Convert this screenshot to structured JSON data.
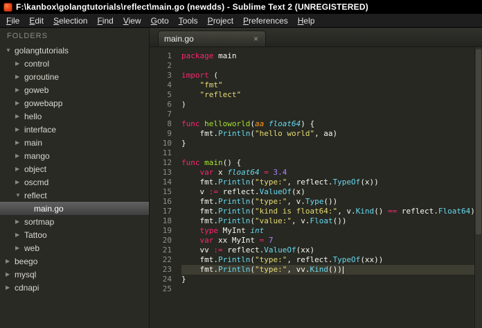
{
  "window": {
    "title": "F:\\kanbox\\golangtutorials\\reflect\\main.go (newdds) - Sublime Text 2 (UNREGISTERED)"
  },
  "menu": {
    "items": [
      "File",
      "Edit",
      "Selection",
      "Find",
      "View",
      "Goto",
      "Tools",
      "Project",
      "Preferences",
      "Help"
    ]
  },
  "icons": {
    "close": "×",
    "folder_expanded": "▼",
    "folder_collapsed": "▶"
  },
  "theme": {
    "editor_bg": "#272822",
    "sidebar_bg": "#2a2a25",
    "current_line_bg": "#3e3d32",
    "keyword": "#f92672",
    "function_name": "#a6e22e",
    "type": "#66d9ef",
    "param": "#fd971f",
    "string": "#e6db74",
    "number": "#ae81ff",
    "text": "#f8f8f2",
    "line_number": "#8f908a"
  },
  "sidebar": {
    "header": "FOLDERS",
    "items": [
      {
        "label": "golangtutorials",
        "level": 0,
        "type": "folder",
        "expanded": true
      },
      {
        "label": "control",
        "level": 1,
        "type": "folder",
        "expanded": false
      },
      {
        "label": "goroutine",
        "level": 1,
        "type": "folder",
        "expanded": false
      },
      {
        "label": "goweb",
        "level": 1,
        "type": "folder",
        "expanded": false
      },
      {
        "label": "gowebapp",
        "level": 1,
        "type": "folder",
        "expanded": false
      },
      {
        "label": "hello",
        "level": 1,
        "type": "folder",
        "expanded": false
      },
      {
        "label": "interface",
        "level": 1,
        "type": "folder",
        "expanded": false
      },
      {
        "label": "main",
        "level": 1,
        "type": "folder",
        "expanded": false
      },
      {
        "label": "mango",
        "level": 1,
        "type": "folder",
        "expanded": false
      },
      {
        "label": "object",
        "level": 1,
        "type": "folder",
        "expanded": false
      },
      {
        "label": "oscmd",
        "level": 1,
        "type": "folder",
        "expanded": false
      },
      {
        "label": "reflect",
        "level": 1,
        "type": "folder",
        "expanded": true
      },
      {
        "label": "main.go",
        "level": 2,
        "type": "file",
        "selected": true
      },
      {
        "label": "sortmap",
        "level": 1,
        "type": "folder",
        "expanded": false
      },
      {
        "label": "Tattoo",
        "level": 1,
        "type": "folder",
        "expanded": false
      },
      {
        "label": "web",
        "level": 1,
        "type": "folder",
        "expanded": false
      },
      {
        "label": "beego",
        "level": 0,
        "type": "folder",
        "expanded": false
      },
      {
        "label": "mysql",
        "level": 0,
        "type": "folder",
        "expanded": false
      },
      {
        "label": "cdnapi",
        "level": 0,
        "type": "folder",
        "expanded": false
      }
    ]
  },
  "editor": {
    "tab": {
      "label": "main.go"
    },
    "lines": [
      {
        "n": 1,
        "tokens": [
          [
            "kw",
            "package"
          ],
          [
            "pl",
            " main"
          ]
        ]
      },
      {
        "n": 2,
        "tokens": []
      },
      {
        "n": 3,
        "tokens": [
          [
            "kw",
            "import"
          ],
          [
            "pl",
            " ("
          ]
        ]
      },
      {
        "n": 4,
        "tokens": [
          [
            "pl",
            "    "
          ],
          [
            "str",
            "\"fmt\""
          ]
        ]
      },
      {
        "n": 5,
        "tokens": [
          [
            "pl",
            "    "
          ],
          [
            "str",
            "\"reflect\""
          ]
        ]
      },
      {
        "n": 6,
        "tokens": [
          [
            "pl",
            ")"
          ]
        ]
      },
      {
        "n": 7,
        "tokens": []
      },
      {
        "n": 8,
        "tokens": [
          [
            "kw",
            "func"
          ],
          [
            "pl",
            " "
          ],
          [
            "fn",
            "helloworld"
          ],
          [
            "pl",
            "("
          ],
          [
            "par",
            "aa"
          ],
          [
            "pl",
            " "
          ],
          [
            "typ",
            "float64"
          ],
          [
            "pl",
            ") {"
          ]
        ]
      },
      {
        "n": 9,
        "tokens": [
          [
            "pl",
            "    fmt."
          ],
          [
            "call",
            "Println"
          ],
          [
            "pl",
            "("
          ],
          [
            "str",
            "\"hello world\""
          ],
          [
            "pl",
            ", aa)"
          ]
        ]
      },
      {
        "n": 10,
        "tokens": [
          [
            "pl",
            "}"
          ]
        ]
      },
      {
        "n": 11,
        "tokens": []
      },
      {
        "n": 12,
        "tokens": [
          [
            "kw",
            "func"
          ],
          [
            "pl",
            " "
          ],
          [
            "fn",
            "main"
          ],
          [
            "pl",
            "() {"
          ]
        ]
      },
      {
        "n": 13,
        "tokens": [
          [
            "pl",
            "    "
          ],
          [
            "kw",
            "var"
          ],
          [
            "pl",
            " x "
          ],
          [
            "typ",
            "float64"
          ],
          [
            "pl",
            " "
          ],
          [
            "kw",
            "="
          ],
          [
            "pl",
            " "
          ],
          [
            "num",
            "3.4"
          ]
        ]
      },
      {
        "n": 14,
        "tokens": [
          [
            "pl",
            "    fmt."
          ],
          [
            "call",
            "Println"
          ],
          [
            "pl",
            "("
          ],
          [
            "str",
            "\"type:\""
          ],
          [
            "pl",
            ", reflect."
          ],
          [
            "call",
            "TypeOf"
          ],
          [
            "pl",
            "(x))"
          ]
        ]
      },
      {
        "n": 15,
        "tokens": [
          [
            "pl",
            "    v "
          ],
          [
            "kw",
            ":="
          ],
          [
            "pl",
            " reflect."
          ],
          [
            "call",
            "ValueOf"
          ],
          [
            "pl",
            "(x)"
          ]
        ]
      },
      {
        "n": 16,
        "tokens": [
          [
            "pl",
            "    fmt."
          ],
          [
            "call",
            "Println"
          ],
          [
            "pl",
            "("
          ],
          [
            "str",
            "\"type:\""
          ],
          [
            "pl",
            ", v."
          ],
          [
            "call",
            "Type"
          ],
          [
            "pl",
            "())"
          ]
        ]
      },
      {
        "n": 17,
        "tokens": [
          [
            "pl",
            "    fmt."
          ],
          [
            "call",
            "Println"
          ],
          [
            "pl",
            "("
          ],
          [
            "str",
            "\"kind is float64:\""
          ],
          [
            "pl",
            ", v."
          ],
          [
            "call",
            "Kind"
          ],
          [
            "pl",
            "() "
          ],
          [
            "kw",
            "=="
          ],
          [
            "pl",
            " reflect."
          ],
          [
            "call",
            "Float64"
          ],
          [
            "pl",
            ")"
          ]
        ]
      },
      {
        "n": 18,
        "tokens": [
          [
            "pl",
            "    fmt."
          ],
          [
            "call",
            "Println"
          ],
          [
            "pl",
            "("
          ],
          [
            "str",
            "\"value:\""
          ],
          [
            "pl",
            ", v."
          ],
          [
            "call",
            "Float"
          ],
          [
            "pl",
            "())"
          ]
        ]
      },
      {
        "n": 19,
        "tokens": [
          [
            "pl",
            "    "
          ],
          [
            "kw",
            "type"
          ],
          [
            "pl",
            " MyInt "
          ],
          [
            "typ",
            "int"
          ]
        ]
      },
      {
        "n": 20,
        "tokens": [
          [
            "pl",
            "    "
          ],
          [
            "kw",
            "var"
          ],
          [
            "pl",
            " xx MyInt "
          ],
          [
            "kw",
            "="
          ],
          [
            "pl",
            " "
          ],
          [
            "num",
            "7"
          ]
        ]
      },
      {
        "n": 21,
        "tokens": [
          [
            "pl",
            "    vv "
          ],
          [
            "kw",
            ":="
          ],
          [
            "pl",
            " reflect."
          ],
          [
            "call",
            "ValueOf"
          ],
          [
            "pl",
            "(xx)"
          ]
        ]
      },
      {
        "n": 22,
        "tokens": [
          [
            "pl",
            "    fmt."
          ],
          [
            "call",
            "Println"
          ],
          [
            "pl",
            "("
          ],
          [
            "str",
            "\"type:\""
          ],
          [
            "pl",
            ", reflect."
          ],
          [
            "call",
            "TypeOf"
          ],
          [
            "pl",
            "(xx))"
          ]
        ]
      },
      {
        "n": 23,
        "current": true,
        "cursor": true,
        "tokens": [
          [
            "pl",
            "    fmt."
          ],
          [
            "call",
            "Println"
          ],
          [
            "pl",
            "("
          ],
          [
            "str",
            "\"type:\""
          ],
          [
            "pl",
            ", vv."
          ],
          [
            "call",
            "Kind"
          ],
          [
            "pl",
            "())"
          ]
        ]
      },
      {
        "n": 24,
        "tokens": [
          [
            "pl",
            "}"
          ]
        ]
      },
      {
        "n": 25,
        "tokens": []
      }
    ]
  }
}
